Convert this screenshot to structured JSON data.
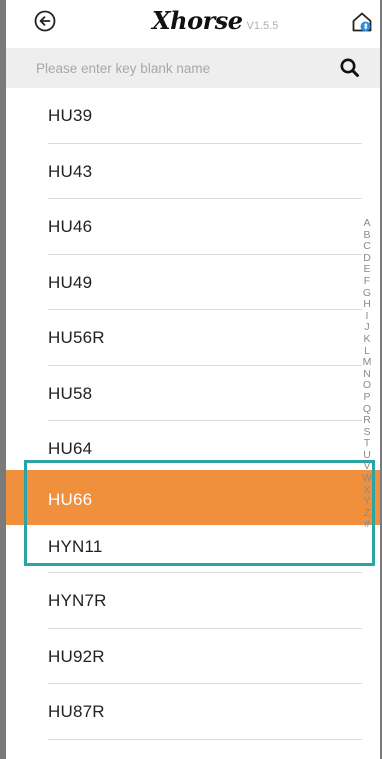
{
  "header": {
    "logo_text": "Xhorse",
    "version": "V1.5.5",
    "back_icon": "circle-arrow-left-icon",
    "home_icon": "home-bluetooth-icon"
  },
  "search": {
    "placeholder": "Please enter key blank name",
    "value": "",
    "icon": "search-icon"
  },
  "list": {
    "items": [
      {
        "label": "HU39"
      },
      {
        "label": "HU43"
      },
      {
        "label": "HU46"
      },
      {
        "label": "HU49"
      },
      {
        "label": "HU56R"
      },
      {
        "label": "HU58"
      },
      {
        "label": "HU64"
      },
      {
        "label": "HU66"
      },
      {
        "label": "HYN11"
      },
      {
        "label": "HYN7R"
      },
      {
        "label": "HU92R"
      },
      {
        "label": "HU87R"
      }
    ],
    "selected_label": "HU66"
  },
  "alphabet_index": [
    "A",
    "B",
    "C",
    "D",
    "E",
    "F",
    "G",
    "H",
    "I",
    "J",
    "K",
    "L",
    "M",
    "N",
    "O",
    "P",
    "Q",
    "R",
    "S",
    "T",
    "U",
    "V",
    "W",
    "X",
    "Y",
    "Z",
    "#"
  ],
  "colors": {
    "accent": "#f0903d",
    "highlight_border": "#2aa4a6",
    "bluetooth": "#2a8ee0"
  }
}
